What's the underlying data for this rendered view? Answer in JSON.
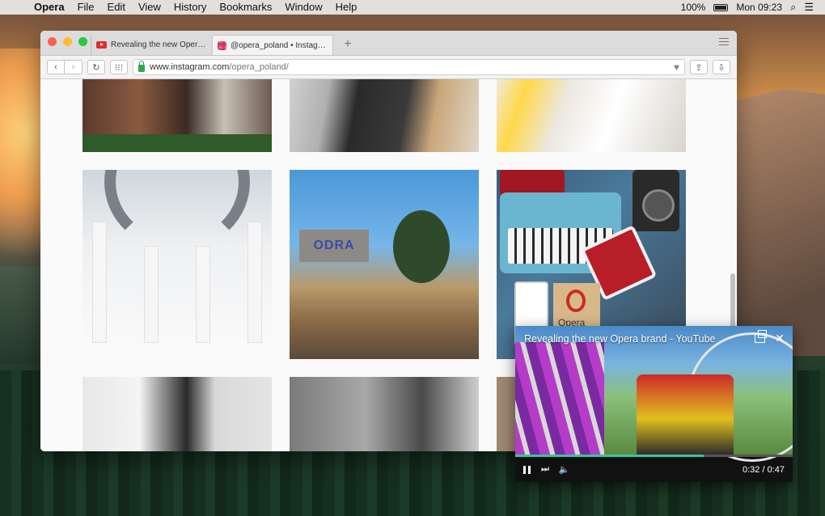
{
  "menubar": {
    "apple_glyph": "",
    "app_name": "Opera",
    "menus": [
      "File",
      "Edit",
      "View",
      "History",
      "Bookmarks",
      "Window",
      "Help"
    ],
    "battery": "100%",
    "clock": "Mon 09:23"
  },
  "browser": {
    "tabs": [
      {
        "title": "Revealing the new Opera brand",
        "favicon": "youtube-icon"
      },
      {
        "title": "@opera_poland • Instagram p",
        "favicon": "instagram-icon"
      }
    ],
    "new_tab_glyph": "+",
    "url_domain": "www.instagram.com",
    "url_path": "/opera_poland/",
    "back_glyph": "‹",
    "forward_glyph": "›",
    "reload_glyph": "↻",
    "heart_glyph": "♥",
    "grid_glyph": "⁝⁝⁝"
  },
  "grid": {
    "photos": [
      "bakery-kitchen-photo",
      "person-at-desk-photo",
      "sketchbook-desk-photo",
      "museum-hall-photo",
      "riverside-bar-photo",
      "typewriter-flatlay-photo",
      "window-studio-photo",
      "wine-glass-photo",
      "partial-photo"
    ],
    "graffiti_text": "ODRA",
    "opera_card_text": "Opera"
  },
  "video": {
    "title": "Revealing the new Opera brand - YouTube",
    "current_time": "0:32",
    "duration": "0:47",
    "time_display": "0:32 / 0:47",
    "progress": 0.68,
    "close_glyph": "✕",
    "next_glyph": "⏭",
    "volume_glyph": "🔈",
    "progress_color": "#36c6a2"
  }
}
